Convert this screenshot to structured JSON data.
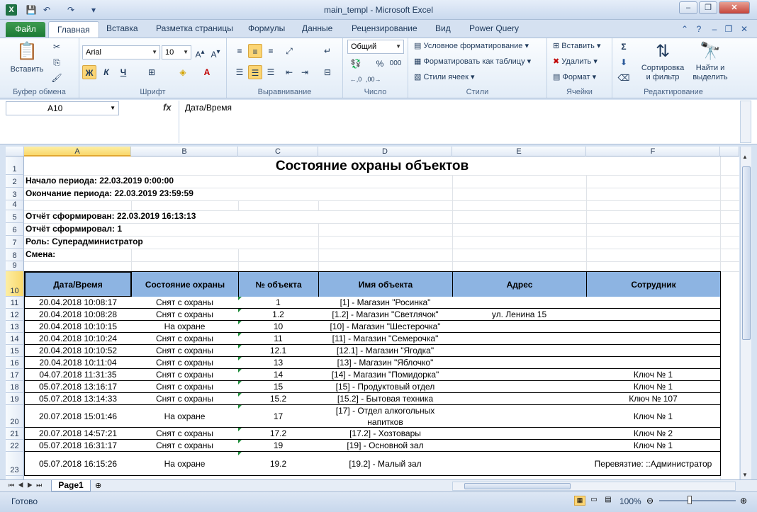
{
  "window": {
    "title": "main_templ  -  Microsoft Excel",
    "app_icon": "X"
  },
  "ribbon_tabs": [
    "Файл",
    "Главная",
    "Вставка",
    "Разметка страницы",
    "Формулы",
    "Данные",
    "Рецензирование",
    "Вид",
    "Power Query"
  ],
  "ribbon": {
    "clipboard": {
      "paste": "Вставить",
      "label": "Буфер обмена"
    },
    "font": {
      "name": "Arial",
      "size": "10",
      "bold": "Ж",
      "italic": "К",
      "underline": "Ч",
      "label": "Шрифт"
    },
    "alignment": {
      "label": "Выравнивание"
    },
    "number": {
      "format": "Общий",
      "label": "Число",
      "percent": "%",
      "thousands": "000"
    },
    "styles": {
      "conditional": "Условное форматирование",
      "table": "Форматировать как таблицу",
      "cell_styles": "Стили ячеек",
      "label": "Стили"
    },
    "cells": {
      "insert": "Вставить",
      "delete": "Удалить",
      "format": "Формат",
      "label": "Ячейки"
    },
    "editing": {
      "sort_l1": "Сортировка",
      "sort_l2": "и фильтр",
      "find_l1": "Найти и",
      "find_l2": "выделить",
      "label": "Редактирование"
    }
  },
  "formula_bar": {
    "name_box": "A10",
    "fx": "fx",
    "content": "Дата/Время"
  },
  "columns": [
    "A",
    "B",
    "C",
    "D",
    "E",
    "F"
  ],
  "rows": [
    "1",
    "2",
    "3",
    "4",
    "5",
    "6",
    "7",
    "8",
    "9",
    "10",
    "11",
    "12",
    "13",
    "14",
    "15",
    "16",
    "17",
    "18",
    "19",
    "20",
    "21",
    "22",
    "23"
  ],
  "report": {
    "title": "Состояние охраны объектов",
    "period_start": "Начало периода: 22.03.2019 0:00:00",
    "period_end": "Окончание периода: 22.03.2019 23:59:59",
    "generated": "Отчёт сформирован: 22.03.2019 16:13:13",
    "generated_by": "Отчёт сформировал: 1",
    "role": "Роль: Суперадминистратор",
    "shift": "Смена:"
  },
  "table": {
    "headers": [
      "Дата/Время",
      "Состояние охраны",
      "№ объекта",
      "Имя объекта",
      "Адрес",
      "Сотрудник"
    ],
    "rows": [
      [
        "20.04.2018 10:08:17",
        "Снят с охраны",
        "1",
        "[1] - Магазин \"Росинка\"",
        "",
        ""
      ],
      [
        "20.04.2018 10:08:28",
        "Снят с охраны",
        "1.2",
        "[1.2] - Магазин \"Светлячок\"",
        "ул. Ленина 15",
        ""
      ],
      [
        "20.04.2018 10:10:15",
        "На охране",
        "10",
        "[10] - Магазин \"Шестерочка\"",
        "",
        ""
      ],
      [
        "20.04.2018 10:10:24",
        "Снят с охраны",
        "11",
        "[11] - Магазин \"Семерочка\"",
        "",
        ""
      ],
      [
        "20.04.2018 10:10:52",
        "Снят с охраны",
        "12.1",
        "[12.1] - Магазин \"Ягодка\"",
        "",
        ""
      ],
      [
        "20.04.2018 10:11:04",
        "Снят с охраны",
        "13",
        "[13] - Магазин \"Яблочко\"",
        "",
        ""
      ],
      [
        "04.07.2018 11:31:35",
        "Снят с охраны",
        "14",
        "[14] - Магазин \"Помидорка\"",
        "",
        "Ключ № 1"
      ],
      [
        "05.07.2018 13:16:17",
        "Снят с охраны",
        "15",
        "[15] - Продуктовый отдел",
        "",
        "Ключ № 1"
      ],
      [
        "05.07.2018 13:14:33",
        "Снят с охраны",
        "15.2",
        "[15.2] - Бытовая техника",
        "",
        "Ключ № 107"
      ],
      [
        "20.07.2018 15:01:46",
        "На охране",
        "17",
        "[17] - Отдел алкогольных напитков",
        "",
        "Ключ № 1"
      ],
      [
        "20.07.2018 14:57:21",
        "Снят с охраны",
        "17.2",
        "[17.2] - Хозтовары",
        "",
        "Ключ № 2"
      ],
      [
        "05.07.2018 16:31:17",
        "Снят с охраны",
        "19",
        "[19] - Основной зал",
        "",
        "Ключ № 1"
      ],
      [
        "05.07.2018 16:15:26",
        "На охране",
        "19.2",
        "[19.2] - Малый зал",
        "",
        "Перевязтие: ::Администратор"
      ]
    ]
  },
  "sheet_tab": "Page1",
  "status": {
    "ready": "Готово",
    "zoom": "100%"
  }
}
